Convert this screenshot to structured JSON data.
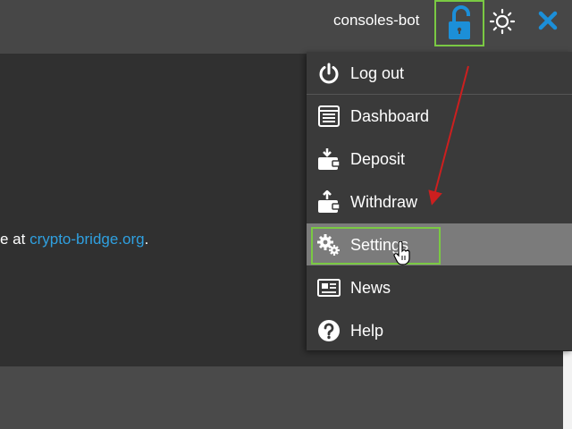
{
  "header": {
    "username": "consoles-bot",
    "lock_icon": "unlock-icon",
    "theme_icon": "sun-icon",
    "close_icon": "close-icon"
  },
  "content": {
    "text_before": "e at ",
    "link_text": "crypto-bridge.org",
    "text_after": "."
  },
  "menu": {
    "items": [
      {
        "label": "Log out",
        "icon": "power-icon"
      },
      {
        "label": "Dashboard",
        "icon": "dashboard-icon"
      },
      {
        "label": "Deposit",
        "icon": "deposit-icon"
      },
      {
        "label": "Withdraw",
        "icon": "withdraw-icon"
      },
      {
        "label": "Settings",
        "icon": "gears-icon",
        "active": true
      },
      {
        "label": "News",
        "icon": "newspaper-icon"
      },
      {
        "label": "Help",
        "icon": "help-icon"
      }
    ]
  },
  "colors": {
    "accent_link": "#2fa0e0",
    "highlight_border": "#7ac943",
    "annotation_arrow": "#cc1f1f",
    "lock_icon": "#1c8fd8",
    "close_icon": "#1c8fd8"
  }
}
